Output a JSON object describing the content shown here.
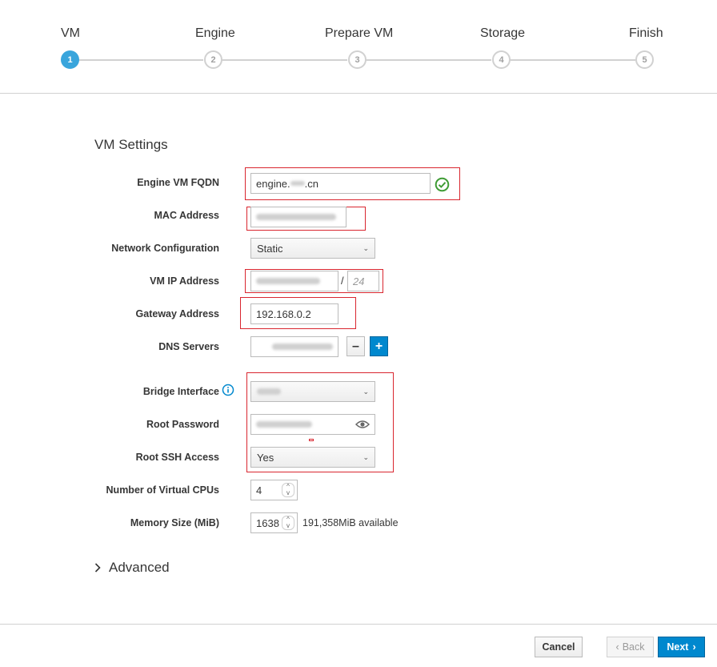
{
  "wizard": {
    "steps": [
      {
        "label": "VM",
        "number": "1",
        "active": true
      },
      {
        "label": "Engine",
        "number": "2",
        "active": false
      },
      {
        "label": "Prepare VM",
        "number": "3",
        "active": false
      },
      {
        "label": "Storage",
        "number": "4",
        "active": false
      },
      {
        "label": "Finish",
        "number": "5",
        "active": false
      }
    ]
  },
  "section": {
    "title": "VM Settings"
  },
  "fields": {
    "fqdn": {
      "label": "Engine VM FQDN",
      "value_prefix": "engine.",
      "value_suffix": ".cn"
    },
    "mac": {
      "label": "MAC Address"
    },
    "network": {
      "label": "Network Configuration",
      "value": "Static"
    },
    "vm_ip": {
      "label": "VM IP Address",
      "separator": "/",
      "prefix_placeholder": "24"
    },
    "gateway": {
      "label": "Gateway Address",
      "value": "192.168.0.2"
    },
    "dns": {
      "label": "DNS Servers"
    },
    "bridge": {
      "label": "Bridge Interface"
    },
    "root_password": {
      "label": "Root Password"
    },
    "root_ssh": {
      "label": "Root SSH Access",
      "value": "Yes"
    },
    "vcpus": {
      "label": "Number of Virtual CPUs",
      "value": "4"
    },
    "memory": {
      "label": "Memory Size (MiB)",
      "value": "1638",
      "available": "191,358MiB available"
    }
  },
  "advanced": {
    "label": "Advanced"
  },
  "footer": {
    "cancel": "Cancel",
    "back": "Back",
    "next": "Next"
  },
  "colors": {
    "accent": "#39a5dc",
    "primary_button": "#0088ce",
    "highlight_box": "#d9262f",
    "valid": "#3f9c35"
  },
  "icons": [
    "check-circle-icon",
    "info-icon",
    "eye-icon",
    "chevron-down-icon",
    "chevron-right-icon",
    "chevron-left-icon",
    "minus-icon",
    "plus-icon"
  ]
}
